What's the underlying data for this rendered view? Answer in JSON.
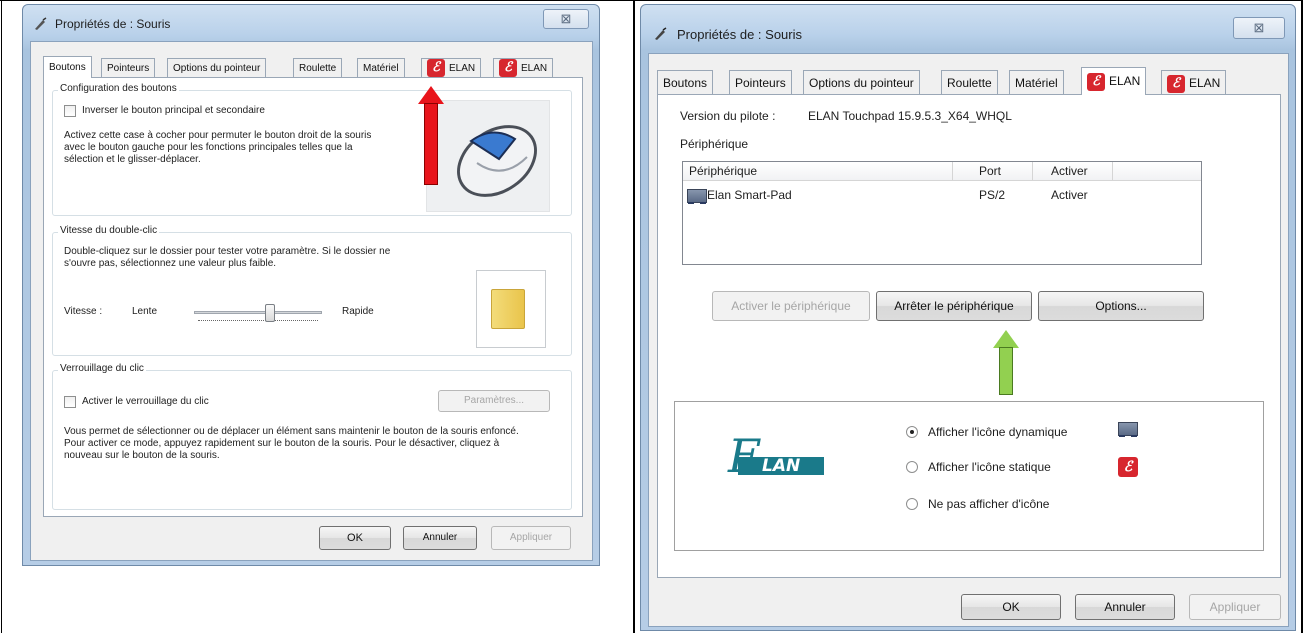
{
  "left_dialog": {
    "title": "Propriétés de : Souris",
    "close_symbol": "⊠",
    "tabs": [
      "Boutons",
      "Pointeurs",
      "Options du pointeur",
      "Roulette",
      "Matériel",
      "ELAN",
      "ELAN"
    ],
    "button_config": {
      "group_label": "Configuration des boutons",
      "checkbox_label": "Inverser le bouton principal et secondaire",
      "description": "Activez cette case à cocher pour permuter le bouton droit de la souris avec le bouton gauche pour les fonctions principales telles que la sélection et le glisser-déplacer."
    },
    "double_click": {
      "group_label": "Vitesse du double-clic",
      "description": "Double-cliquez sur le dossier pour tester votre paramètre. Si le dossier ne s'ouvre pas, sélectionnez une valeur plus faible.",
      "speed_label": "Vitesse :",
      "slow_label": "Lente",
      "fast_label": "Rapide",
      "slider_position": 0.6
    },
    "click_lock": {
      "group_label": "Verrouillage du clic",
      "checkbox_label": "Activer le verrouillage du clic",
      "settings_button": "Paramètres...",
      "description": "Vous permet de sélectionner ou de déplacer un élément sans maintenir le bouton de la souris enfoncé. Pour activer ce mode, appuyez rapidement sur le bouton de la souris. Pour le désactiver, cliquez à nouveau sur le bouton de la souris."
    },
    "buttons": {
      "ok": "OK",
      "cancel": "Annuler",
      "apply": "Appliquer"
    }
  },
  "right_dialog": {
    "title": "Propriétés de : Souris",
    "close_symbol": "⊠",
    "tabs": [
      "Boutons",
      "Pointeurs",
      "Options du pointeur",
      "Roulette",
      "Matériel",
      "ELAN",
      "ELAN"
    ],
    "driver_label": "Version du pilote :",
    "driver_value": "ELAN Touchpad 15.9.5.3_X64_WHQL",
    "device_section_label": "Périphérique",
    "device_table": {
      "columns": [
        "Périphérique",
        "Port",
        "Activer"
      ],
      "rows": [
        {
          "name": "Elan Smart-Pad",
          "port": "PS/2",
          "status": "Activer"
        }
      ]
    },
    "device_buttons": {
      "enable": "Activer le périphérique",
      "stop": "Arrêter le périphérique",
      "options": "Options..."
    },
    "icon_options": {
      "logo_text": "LAN",
      "logo_letter": "E",
      "options": [
        "Afficher l'icône dynamique",
        "Afficher l'icône statique",
        "Ne pas afficher d'icône"
      ],
      "selected_index": 0
    },
    "buttons": {
      "ok": "OK",
      "cancel": "Annuler",
      "apply": "Appliquer"
    }
  },
  "colors": {
    "red_arrow": "#e8141b",
    "green_arrow": "#92d050",
    "elan_red": "#d7262e",
    "elan_teal": "#1a7a8a"
  },
  "icons": [
    "mouse-pointer-icon",
    "close-icon",
    "elan-tab-icon",
    "mouse-image",
    "folder-icon",
    "touchpad-icon",
    "elan-logo"
  ]
}
